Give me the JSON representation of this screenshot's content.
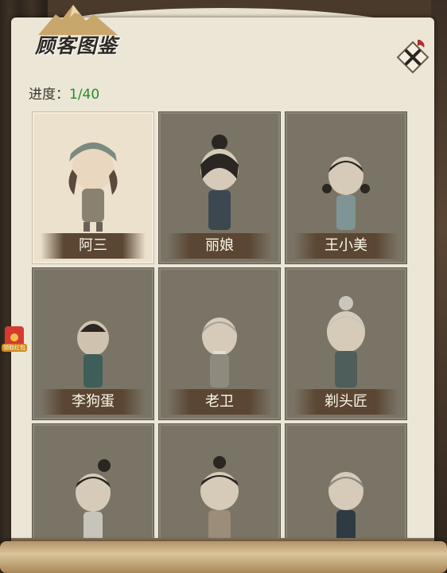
{
  "header": {
    "title": "顾客图鉴",
    "progress_label": "进度：",
    "progress_value": "1/40"
  },
  "customers": [
    {
      "name": "阿三",
      "unlocked": true
    },
    {
      "name": "丽娘",
      "unlocked": false
    },
    {
      "name": "王小美",
      "unlocked": false
    },
    {
      "name": "李狗蛋",
      "unlocked": false
    },
    {
      "name": "老卫",
      "unlocked": false
    },
    {
      "name": "剃头匠",
      "unlocked": false
    },
    {
      "name": "",
      "unlocked": false
    },
    {
      "name": "",
      "unlocked": false
    },
    {
      "name": "",
      "unlocked": false
    }
  ],
  "side": {
    "gift_label": "领取红包"
  },
  "colors": {
    "progress": "#2a8a2e",
    "parchment": "#ece6d6",
    "card_locked": "#7a7466",
    "card_unlocked": "#ebe1cc",
    "label_bar": "#5a4632"
  },
  "icons": {
    "close": "crossed-swords-close-icon",
    "gift": "red-envelope-icon"
  }
}
